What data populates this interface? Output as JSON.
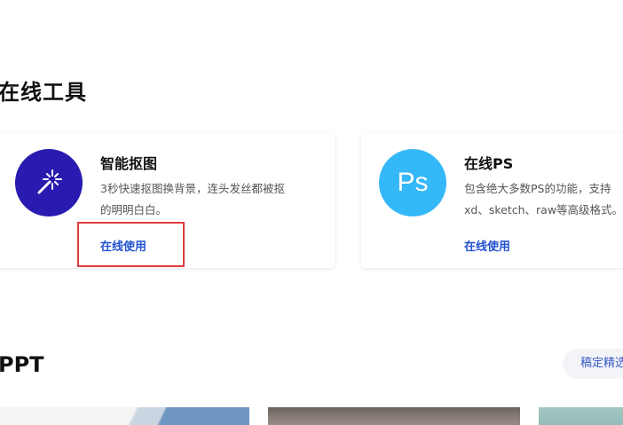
{
  "sections": {
    "online_tools_title": "在线工具",
    "ppt_title": "PPT"
  },
  "tools": [
    {
      "title": "智能抠图",
      "desc_line1": "3秒快速抠图换背景，连头发丝都被抠",
      "desc_line2": "的明明白白。",
      "link": "在线使用",
      "icon": "magic-wand-icon",
      "icon_color": "#2a1bb0"
    },
    {
      "title": "在线PS",
      "desc_line1": "包含绝大多数PS的功能，支持",
      "desc_line2": "xd、sketch、raw等高级格式。",
      "link": "在线使用",
      "icon": "ps-icon",
      "icon_text": "Ps",
      "icon_color": "#35b8f8"
    }
  ],
  "ppt": {
    "curated_button": "稿定精选"
  },
  "colors": {
    "link": "#2353cf",
    "highlight_border": "#e03c3c"
  }
}
